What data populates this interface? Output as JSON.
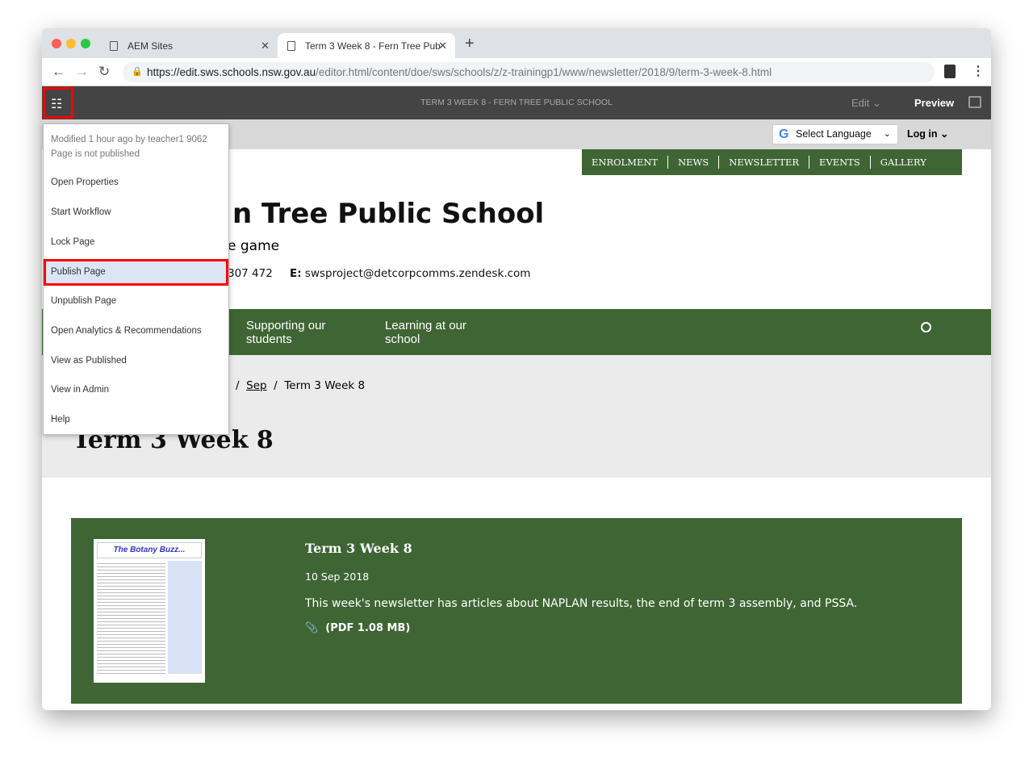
{
  "browser": {
    "tabs": [
      {
        "label": "AEM Sites"
      },
      {
        "label": "Term 3 Week 8 - Fern Tree Pub"
      }
    ],
    "url_host": "https://edit.sws.schools.nsw.gov.au",
    "url_path": "/editor.html/content/doe/sws/schools/z/z-trainingp1/www/newsletter/2018/9/term-3-week-8.html"
  },
  "aem": {
    "title": "TERM 3 WEEK 8 - FERN TREE PUBLIC SCHOOL",
    "edit_label": "Edit",
    "preview_label": "Preview"
  },
  "page_menu": {
    "modified": "Modified 1 hour ago by teacher1 9062",
    "status": "Page is not published",
    "items": [
      "Open Properties",
      "Start Workflow",
      "Lock Page",
      "Publish Page",
      "Unpublish Page",
      "Open Analytics & Recommendations",
      "View as Published",
      "View in Admin",
      "Help"
    ]
  },
  "site": {
    "select_language": "Select Language",
    "login": "Log in",
    "top_nav": [
      "ENROLMENT",
      "NEWS",
      "NEWSLETTER",
      "EVENTS",
      "GALLERY"
    ],
    "school_name": "n Tree Public School",
    "tagline": "e game",
    "phone": "307 472",
    "email_label": "E:",
    "email": "swsproject@detcorpcomms.zendesk.com",
    "main_nav": [
      "Supporting our students",
      "Learning at our school"
    ],
    "breadcrumb": [
      "Sep",
      "Term 3 Week 8"
    ],
    "page_title": "Term 3 Week 8"
  },
  "newsletter": {
    "title": "Term 3 Week 8",
    "date": "10 Sep 2018",
    "description": "This week's newsletter has articles about NAPLAN results, the end of term 3 assembly, and PSSA.",
    "file": "(PDF 1.08 MB)",
    "thumb_title": "The Botany Buzz..."
  },
  "colors": {
    "brand_green": "#3f6534",
    "toolbar": "#444444",
    "highlight": "#dbe5f5",
    "annotation": "#ff0000"
  }
}
